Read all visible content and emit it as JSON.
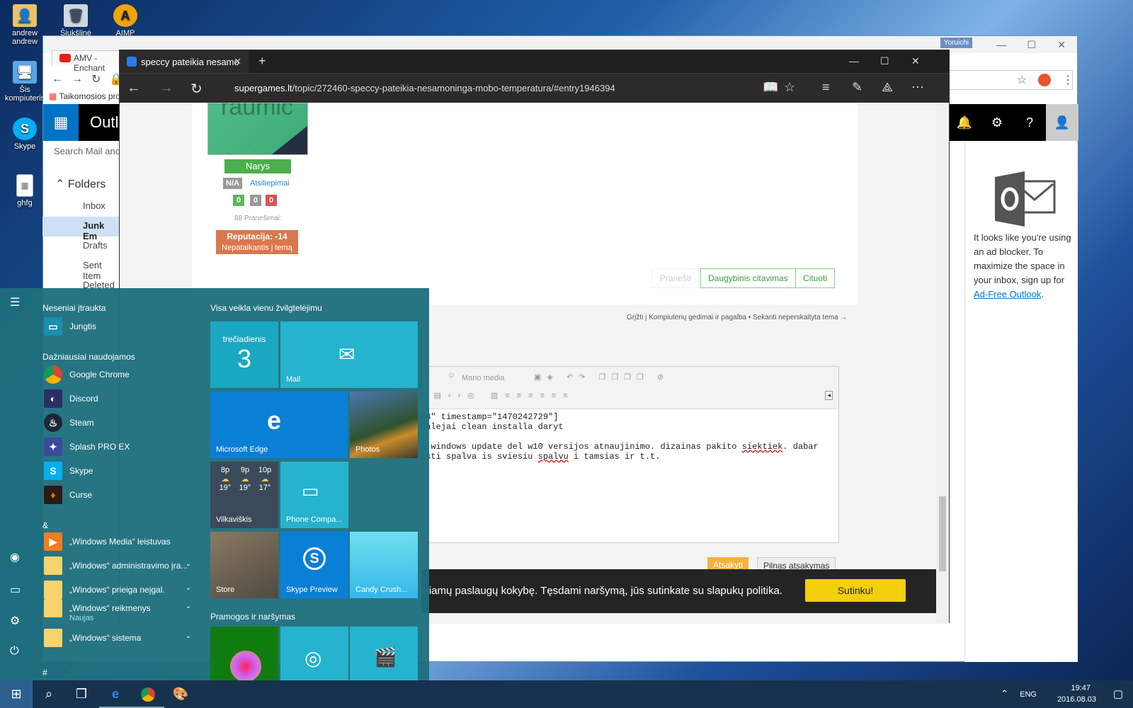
{
  "desktop": {
    "icons": [
      {
        "label": "andrew\nandrew"
      },
      {
        "label": "Šiukšlinė"
      },
      {
        "label": "AIMP"
      },
      {
        "label": "Šis kompiuteris"
      },
      {
        "label": "Skype"
      },
      {
        "label": "ghfg"
      }
    ]
  },
  "chrome": {
    "tab_title": "AMV - Enchant",
    "person": "Yoruichi",
    "bookmark": "Taikomosios pro",
    "outlook": {
      "app_name": "Outl",
      "search_placeholder": "Search Mail and",
      "folders_header": "Folders",
      "folders": [
        "Inbox",
        "Junk Em",
        "Drafts",
        "Sent Item",
        "Deleted"
      ],
      "selected_folder": "Junk Em",
      "ad_text_1": "It looks like you're using an ad blocker. To maximize the space in your inbox, sign up for ",
      "ad_link": "Ad-Free Outlook",
      "ad_text_2": "."
    }
  },
  "edge": {
    "tab_title": "speccy pateikia nesamo",
    "url_domain": "supergames.lt",
    "url_path": "/topic/272460-speccy-pateikia-nesamoninga-mobo-temperatura/#entry1946394",
    "post": {
      "avatar_text": "raumic",
      "rank": "Narys",
      "na": "N/A",
      "atsiliepimai": "Atsiliepimai",
      "counts": [
        "0",
        "0",
        "0"
      ],
      "posts": "88 Pranešimai:",
      "reputacija": "Reputacija: -14",
      "reputacija_sub": "Nepataikantis į temą",
      "pranesti": "Pranešti",
      "multi_quote": "Daugybinis citavimas",
      "quote": "Cituoti"
    },
    "breadcrumbs": "Grįžti į Kompiuterių gedimai ir pagalba • Sekanti neperskaityta tema →",
    "editor": {
      "toolbar_media": "Mano media",
      "line1": "94\" timestamp=\"1470242729\"]",
      "line2": "Galejai clean installa daryt",
      "line3a": "a windows update del w10 versijos atnaujinimo. dizainas pakito ",
      "line3_err": "siektiek",
      "line3b": ". dabar",
      "line4a": "isti spalva is sviesiu ",
      "line4_err": "spalvu",
      "line4b": " i tamsias ir t.t."
    },
    "reply": "Atsakyti",
    "full_reply": "Pilnas atsakymas",
    "cookie": {
      "message": "ikiamų paslaugų kokybę. Tęsdami naršymą, jūs sutinkate su slapukų politika.",
      "accept": "Sutinku!"
    }
  },
  "start_menu": {
    "recent_header": "Neseniai įtraukta",
    "recent": [
      {
        "label": "Jungtis"
      }
    ],
    "frequent_header": "Dažniausiai naudojamos",
    "frequent": [
      {
        "label": "Google Chrome"
      },
      {
        "label": "Discord"
      },
      {
        "label": "Steam"
      },
      {
        "label": "Splash PRO EX"
      },
      {
        "label": "Skype"
      },
      {
        "label": "Curse"
      }
    ],
    "amp_header": "&",
    "groups": [
      {
        "label": "„Windows Media“ leistuvas"
      },
      {
        "label": "„Windows“ administravimo įra..."
      },
      {
        "label": "„Windows“ prieiga neįgal."
      },
      {
        "label": "„Windows“ reikmenys",
        "sub": "Naujas"
      },
      {
        "label": "„Windows“ sistema"
      }
    ],
    "hash_header": "#",
    "tiles_header": "Visa veikla vienu žvilgtelėjimu",
    "tiles_header2": "Pramogos ir naršymas",
    "calendar": {
      "day": "trečiadienis",
      "date": "3"
    },
    "tiles": {
      "mail": "Mail",
      "edge": "Microsoft Edge",
      "photos": "Photos",
      "weather_place": "Vilkaviškis",
      "phone": "Phone Compa...",
      "store": "Store",
      "skype": "Skype Preview",
      "candy": "Candy Crush..."
    },
    "weather": [
      {
        "hour": "8p",
        "temp": "19°"
      },
      {
        "hour": "9p",
        "temp": "19°"
      },
      {
        "hour": "10p",
        "temp": "17°"
      }
    ]
  },
  "taskbar": {
    "lang": "ENG",
    "time": "19:47",
    "date": "2016.08.03"
  }
}
